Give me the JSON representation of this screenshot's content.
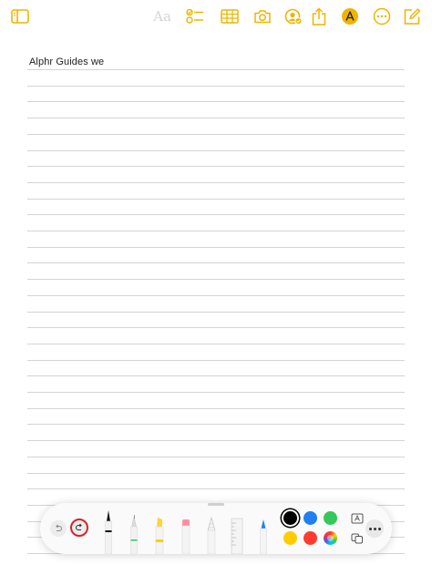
{
  "note": {
    "text": "Alphr Guides we"
  },
  "toolbar": {
    "format_label": "Aa"
  },
  "colors": {
    "accent": "#f0b400",
    "redo_highlight": "#d8232a",
    "palette": [
      "#000000",
      "#1f7ff3",
      "#34c759",
      "#ffcc00",
      "#ff3b30"
    ]
  },
  "icons": {
    "sidebar": "sidebar-icon",
    "checklist": "checklist-icon",
    "table": "table-icon",
    "camera": "camera-icon",
    "collaborate": "collaborate-icon",
    "share": "share-icon",
    "markup": "markup-icon",
    "more": "ellipsis-icon",
    "compose": "compose-icon"
  }
}
